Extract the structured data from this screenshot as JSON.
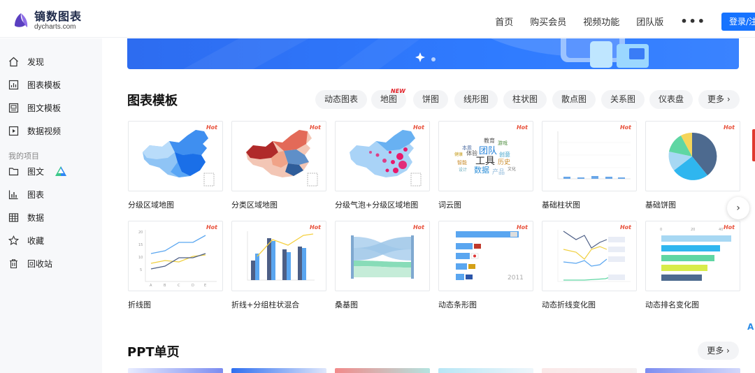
{
  "brand": {
    "title": "镝数图表",
    "subtitle": "dycharts.com"
  },
  "nav": {
    "items": [
      "首页",
      "购买会员",
      "视频功能",
      "团队版"
    ],
    "more": "•••",
    "login": "登录/注"
  },
  "sidebar": {
    "items": [
      {
        "label": "发现",
        "icon": "home-icon"
      },
      {
        "label": "图表模板",
        "icon": "chart-template-icon"
      },
      {
        "label": "图文模板",
        "icon": "image-text-template-icon"
      },
      {
        "label": "数据视频",
        "icon": "video-icon"
      }
    ],
    "section": "我的项目",
    "project_items": [
      {
        "label": "图文",
        "icon": "folder-icon"
      },
      {
        "label": "图表",
        "icon": "bar-chart-icon"
      },
      {
        "label": "数据",
        "icon": "table-icon"
      },
      {
        "label": "收藏",
        "icon": "star-icon"
      },
      {
        "label": "回收站",
        "icon": "trash-icon"
      }
    ]
  },
  "chart_section": {
    "title": "图表模板",
    "filters": [
      "动态图表",
      "地图",
      "饼图",
      "线形图",
      "柱状图",
      "散点图",
      "关系图",
      "仪表盘",
      "更多 ›"
    ],
    "new_badge": "NEW",
    "hot_badge": "Hot",
    "cards": [
      {
        "label": "分级区域地图",
        "thumb": "choropleth-map"
      },
      {
        "label": "分类区域地图",
        "thumb": "category-map"
      },
      {
        "label": "分级气泡+分级区域地图",
        "thumb": "bubble-map"
      },
      {
        "label": "词云图",
        "thumb": "word-cloud"
      },
      {
        "label": "基础柱状图",
        "thumb": "basic-bar"
      },
      {
        "label": "基础饼图",
        "thumb": "basic-pie"
      },
      {
        "label": "折线图",
        "thumb": "line"
      },
      {
        "label": "折线+分组柱状混合",
        "thumb": "line-bar-combo"
      },
      {
        "label": "桑基图",
        "thumb": "sankey"
      },
      {
        "label": "动态条形图",
        "thumb": "racing-bar"
      },
      {
        "label": "动态折线变化图",
        "thumb": "racing-line"
      },
      {
        "label": "动态排名变化图",
        "thumb": "racing-rank"
      }
    ],
    "wordcloud_words": [
      "教育",
      "游戏",
      "本质",
      "团队",
      "体验",
      "创意",
      "工具",
      "历史",
      "数据",
      "产品",
      "智能",
      "文化",
      "设计",
      "健康"
    ],
    "racing_year": "2011",
    "line_axis_x": [
      "A",
      "B",
      "C",
      "D",
      "E"
    ],
    "line_axis_y": [
      "20",
      "15",
      "10",
      "5"
    ],
    "rank_axis": [
      "0",
      "20",
      "40"
    ]
  },
  "ppt_section": {
    "title": "PPT单页",
    "more": "更多 ›"
  },
  "next_arrow": "›",
  "edge_glyph": "A"
}
